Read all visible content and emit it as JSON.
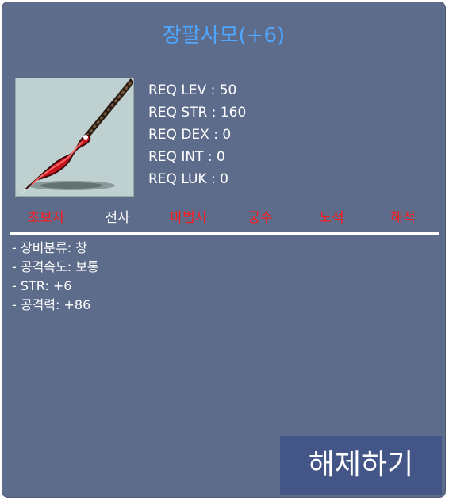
{
  "item": {
    "name": "장팔사모(+6)",
    "icon": "spear-icon"
  },
  "requirements": [
    "REQ LEV : 50",
    "REQ STR : 160",
    "REQ DEX : 0",
    "REQ INT : 0",
    "REQ LUK : 0"
  ],
  "jobs": [
    {
      "label": "초보자",
      "allowed": false
    },
    {
      "label": "전사",
      "allowed": true
    },
    {
      "label": "마법사",
      "allowed": false
    },
    {
      "label": "궁수",
      "allowed": false
    },
    {
      "label": "도적",
      "allowed": false
    },
    {
      "label": "해적",
      "allowed": false
    }
  ],
  "stats": [
    "- 장비분류: 창",
    "- 공격속도: 보통",
    "- STR: +6",
    "- 공격력: +86"
  ],
  "actions": {
    "unequip_label": "해제하기"
  },
  "colors": {
    "panel": "#5e6c8c",
    "title": "#4da6ff",
    "restricted_job": "#ff1a1a",
    "allowed_job": "#ffffff",
    "button": "#445688"
  }
}
